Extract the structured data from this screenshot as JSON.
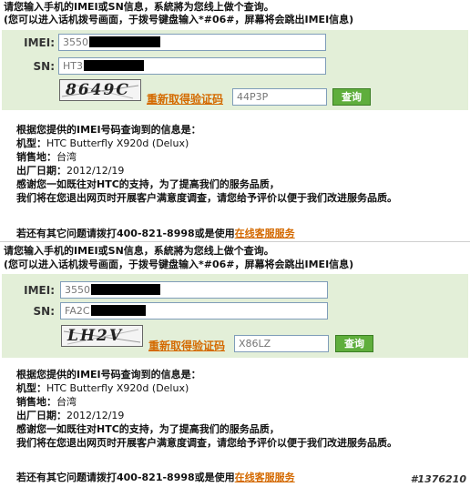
{
  "colors": {
    "form_background": "#e3efd8",
    "link": "#d46a00",
    "button": "#5fae3c"
  },
  "panels": [
    {
      "instruction_line1": "请您输入手机的IMEI或SN信息，系統將为您线上做个查询。",
      "instruction_line2": "(您可以进入话机拨号画面，于拨号键盘输入*#06#，屏幕将会跳出IMEI信息)",
      "imei_label": "IMEI:",
      "imei_value": "3550",
      "sn_label": "SN:",
      "sn_value": "HT3",
      "captcha_text": "8649C",
      "refresh_link": "重新取得验证码",
      "captcha_input_value": "44P3P",
      "submit_label": "查询",
      "result_heading": "根据您提供的IMEI号码查询到的信息是：",
      "model_label": "机型：",
      "model_value": "HTC Butterfly X920d (Delux)",
      "region_label": "销售地：",
      "region_value": "台湾",
      "date_label": "出厂日期：",
      "date_value": "2012/12/19",
      "thanks_line1": "感谢您一如既往对HTC的支持，为了提高我们的服务品质，",
      "thanks_line2": "我们将在您退出网页时开展客户满意度调查，请您给予评价以便于我们改进服务品质。",
      "footer_text": "若还有其它问题请拨打400-821-8998或是使用",
      "footer_link": "在线客服服务"
    },
    {
      "instruction_line1": "请您输入手机的IMEI或SN信息，系統將为您线上做个查询。",
      "instruction_line2": "(您可以进入话机拨号画面，于拨号键盘输入*#06#，屏幕将会跳出IMEI信息)",
      "imei_label": "IMEI:",
      "imei_value": "3550",
      "sn_label": "SN:",
      "sn_value": "FA2C",
      "captcha_text": "LH2V",
      "refresh_link": "重新取得验证码",
      "captcha_input_value": "X86LZ",
      "submit_label": "查询",
      "result_heading": "根据您提供的IMEI号码查询到的信息是：",
      "model_label": "机型：",
      "model_value": "HTC Butterfly X920d (Delux)",
      "region_label": "销售地：",
      "region_value": "台湾",
      "date_label": "出厂日期：",
      "date_value": "2012/12/19",
      "thanks_line1": "感谢您一如既往对HTC的支持，为了提高我们的服务品质，",
      "thanks_line2": "我们将在您退出网页时开展客户满意度调查，请您给予评价以便于我们改进服务品质。",
      "footer_text": "若还有其它问题请拨打400-821-8998或是使用",
      "footer_link": "在线客服服务"
    }
  ],
  "watermark": "#1376210"
}
